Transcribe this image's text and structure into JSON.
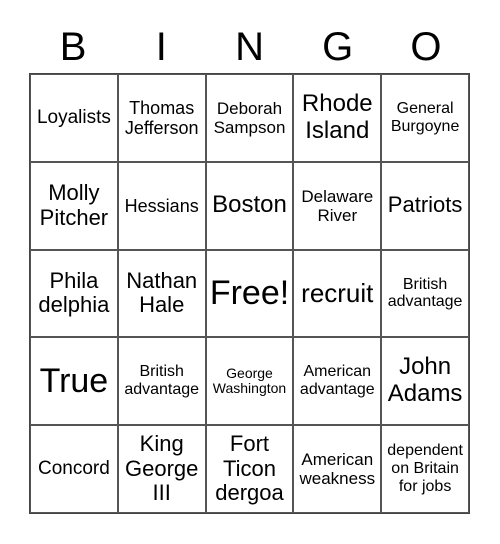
{
  "header": [
    "B",
    "I",
    "N",
    "G",
    "O"
  ],
  "cells": [
    [
      "Loyalists",
      "Thomas Jefferson",
      "Deborah Sampson",
      "Rhode Island",
      "General Burgoyne"
    ],
    [
      "Molly Pitcher",
      "Hessians",
      "Boston",
      "Delaware River",
      "Patriots"
    ],
    [
      "Phila delphia",
      "Nathan Hale",
      "Free!",
      "recruit",
      "British advantage"
    ],
    [
      "True",
      "British advantage",
      "George Washington",
      "American advantage",
      "John Adams"
    ],
    [
      "Concord",
      "King George III",
      "Fort Ticon dergoa",
      "American weakness",
      "dependent on Britain for jobs"
    ]
  ]
}
